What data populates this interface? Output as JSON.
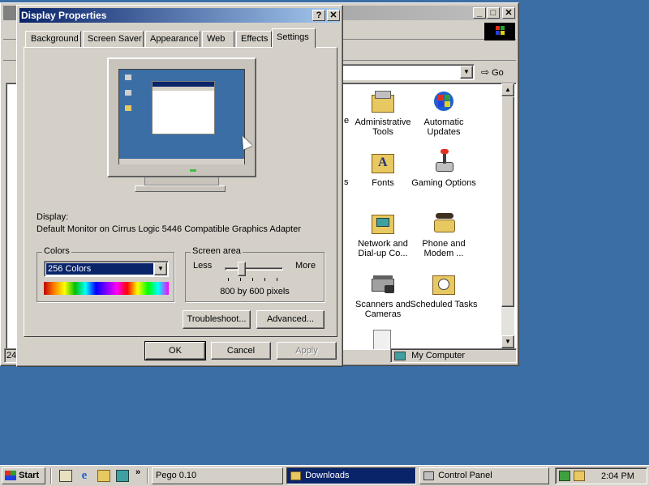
{
  "control_panel": {
    "title": "Control Panel",
    "go_label": "Go",
    "status_right": "My Computer",
    "status_left": "24",
    "items": [
      {
        "label": "Administrative Tools",
        "icon": "administrative-tools-icon"
      },
      {
        "label": "Automatic Updates",
        "icon": "automatic-updates-icon"
      },
      {
        "label": "Fonts",
        "icon": "fonts-icon"
      },
      {
        "label": "Gaming Options",
        "icon": "gaming-options-icon"
      },
      {
        "label": "Network and Dial-up Co...",
        "icon": "network-icon"
      },
      {
        "label": "Phone and Modem ...",
        "icon": "phone-modem-icon"
      },
      {
        "label": "Scanners and Cameras",
        "icon": "scanners-icon"
      },
      {
        "label": "Scheduled Tasks",
        "icon": "scheduled-tasks-icon"
      }
    ],
    "partial_labels": [
      "e",
      "s"
    ]
  },
  "dialog": {
    "title": "Display Properties",
    "tabs": [
      "Background",
      "Screen Saver",
      "Appearance",
      "Web",
      "Effects",
      "Settings"
    ],
    "active_tab": "Settings",
    "display_label": "Display:",
    "display_value": "Default Monitor on Cirrus Logic 5446 Compatible Graphics Adapter",
    "colors": {
      "group_label": "Colors",
      "selected": "256 Colors"
    },
    "screen_area": {
      "group_label": "Screen area",
      "less": "Less",
      "more": "More",
      "value_text": "800 by 600 pixels",
      "slider_level": 0.25
    },
    "troubleshoot_label": "Troubleshoot...",
    "advanced_label": "Advanced...",
    "ok_label": "OK",
    "cancel_label": "Cancel",
    "apply_label": "Apply"
  },
  "taskbar": {
    "start_label": "Start",
    "tasks": [
      {
        "label": "Pego 0.10",
        "active": false
      },
      {
        "label": "Downloads",
        "active": true
      },
      {
        "label": "Control Panel",
        "active": false
      }
    ],
    "clock": "2:04 PM"
  },
  "colors": {
    "desktop": "#3a6ea5",
    "title_active": "#0a246a",
    "title_inactive": "#808080",
    "face": "#d4d0c8"
  }
}
